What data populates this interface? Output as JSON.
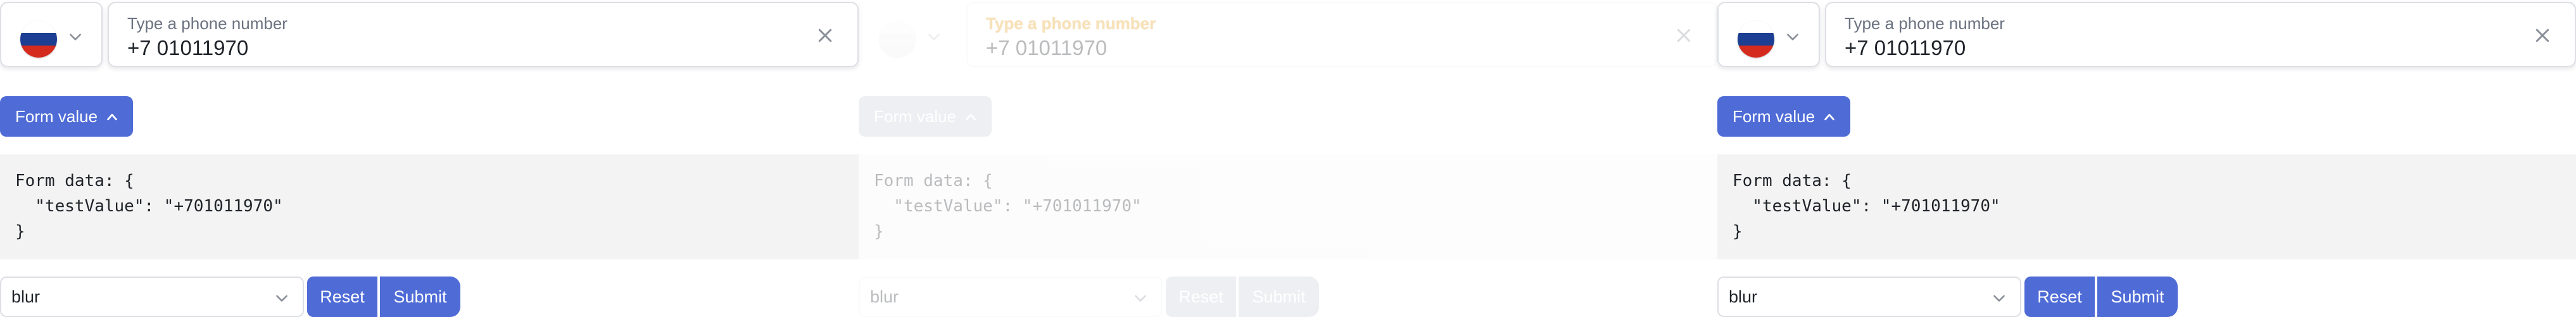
{
  "panels": [
    {
      "phone_label": "Type a phone number",
      "phone_value": "+7 01011970",
      "form_value_button": "Form value",
      "code_lines": [
        "Form data: {",
        "  \"testValue\": \"+701011970\"",
        "}"
      ],
      "select_value": "blur",
      "reset_label": "Reset",
      "submit_label": "Submit"
    },
    {
      "phone_label": "Type a phone number",
      "phone_value": "+7 01011970",
      "form_value_button": "Form value",
      "code_lines": [
        "Form data: {",
        "  \"testValue\": \"+701011970\"",
        "}"
      ],
      "select_value": "blur",
      "reset_label": "Reset",
      "submit_label": "Submit"
    },
    {
      "phone_label": "Type a phone number",
      "phone_value": "+7 01011970",
      "form_value_button": "Form value",
      "code_lines": [
        "Form data: {",
        "  \"testValue\": \"+701011970\"",
        "}"
      ],
      "select_value": "blur",
      "reset_label": "Reset",
      "submit_label": "Submit"
    }
  ],
  "icons": {
    "flag": "russia-flag-icon",
    "country_chevron": "chevron-down-icon",
    "clear": "close-icon",
    "toggle": "chevron-up-icon",
    "select_chevron": "chevron-down-icon"
  },
  "colors": {
    "accent": "#4e6bd6",
    "code_bg": "#f3f3f3",
    "border": "#dcdfe4",
    "glitch_label": "#e8a317"
  }
}
